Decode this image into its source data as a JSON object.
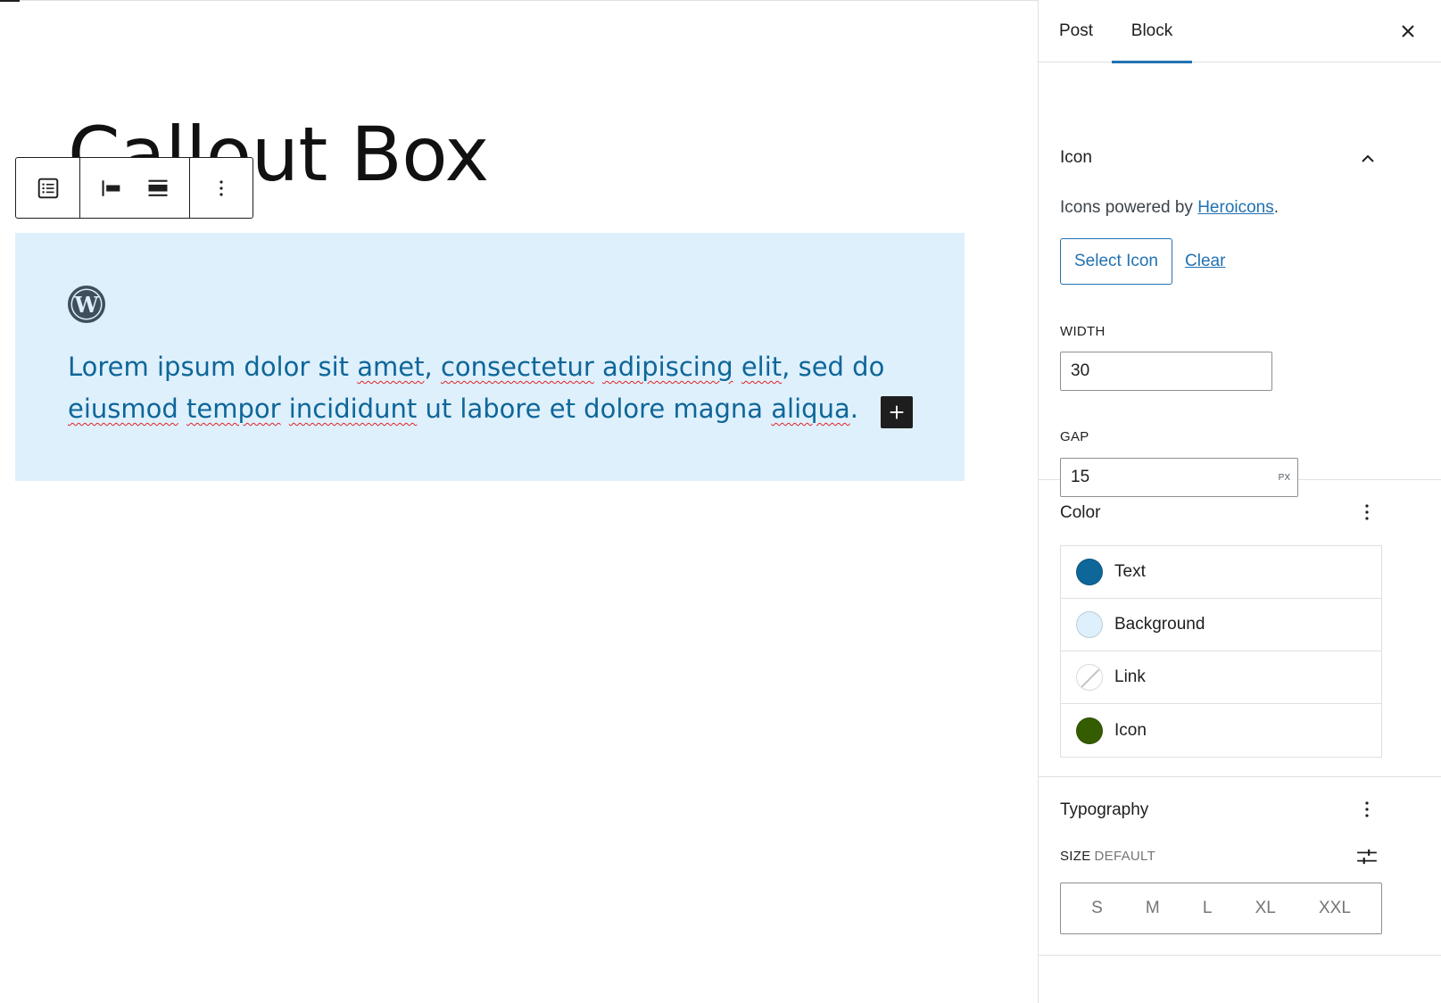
{
  "editor": {
    "post_title": "Callout Box",
    "callout": {
      "text_parts": [
        {
          "t": "Lorem ipsum dolor sit ",
          "sp": false
        },
        {
          "t": "amet",
          "sp": true
        },
        {
          "t": ", ",
          "sp": false
        },
        {
          "t": "consectetur",
          "sp": true
        },
        {
          "t": " ",
          "sp": false
        },
        {
          "t": "adipiscing",
          "sp": true
        },
        {
          "t": " ",
          "sp": false
        },
        {
          "t": "elit",
          "sp": true
        },
        {
          "t": ", sed do ",
          "sp": false
        },
        {
          "t": "eiusmod",
          "sp": true
        },
        {
          "t": " ",
          "sp": false
        },
        {
          "t": "tempor",
          "sp": true
        },
        {
          "t": " ",
          "sp": false
        },
        {
          "t": "incididunt",
          "sp": true
        },
        {
          "t": " ut labore et dolore magna ",
          "sp": false
        },
        {
          "t": "aliqua",
          "sp": true
        },
        {
          "t": ".",
          "sp": false
        }
      ],
      "background": "#def0fc",
      "text_color": "#0e6699"
    },
    "toolbar_icons": [
      "list-view-icon",
      "align-left-icon",
      "align-wide-icon",
      "more-options-icon"
    ]
  },
  "sidebar": {
    "tabs": {
      "post": "Post",
      "block": "Block"
    },
    "icon_panel": {
      "title": "Icon",
      "powered_prefix": "Icons powered by ",
      "powered_link": "Heroicons",
      "powered_suffix": ".",
      "select_label": "Select Icon",
      "clear_label": "Clear",
      "width_label": "WIDTH",
      "width_value": "30",
      "gap_label": "GAP",
      "gap_value": "15",
      "gap_unit": "PX"
    },
    "color_panel": {
      "title": "Color",
      "items": [
        {
          "label": "Text",
          "color": "#0e6699"
        },
        {
          "label": "Background",
          "color": "#def0fc"
        },
        {
          "label": "Link",
          "color": "none"
        },
        {
          "label": "Icon",
          "color": "#345c00"
        }
      ]
    },
    "typography_panel": {
      "title": "Typography",
      "size_label": "SIZE",
      "size_default": "DEFAULT",
      "sizes": [
        "S",
        "M",
        "L",
        "XL",
        "XXL"
      ]
    }
  },
  "colors": {
    "accent": "#2271b1",
    "toolbar_border": "#1e1e1e"
  }
}
